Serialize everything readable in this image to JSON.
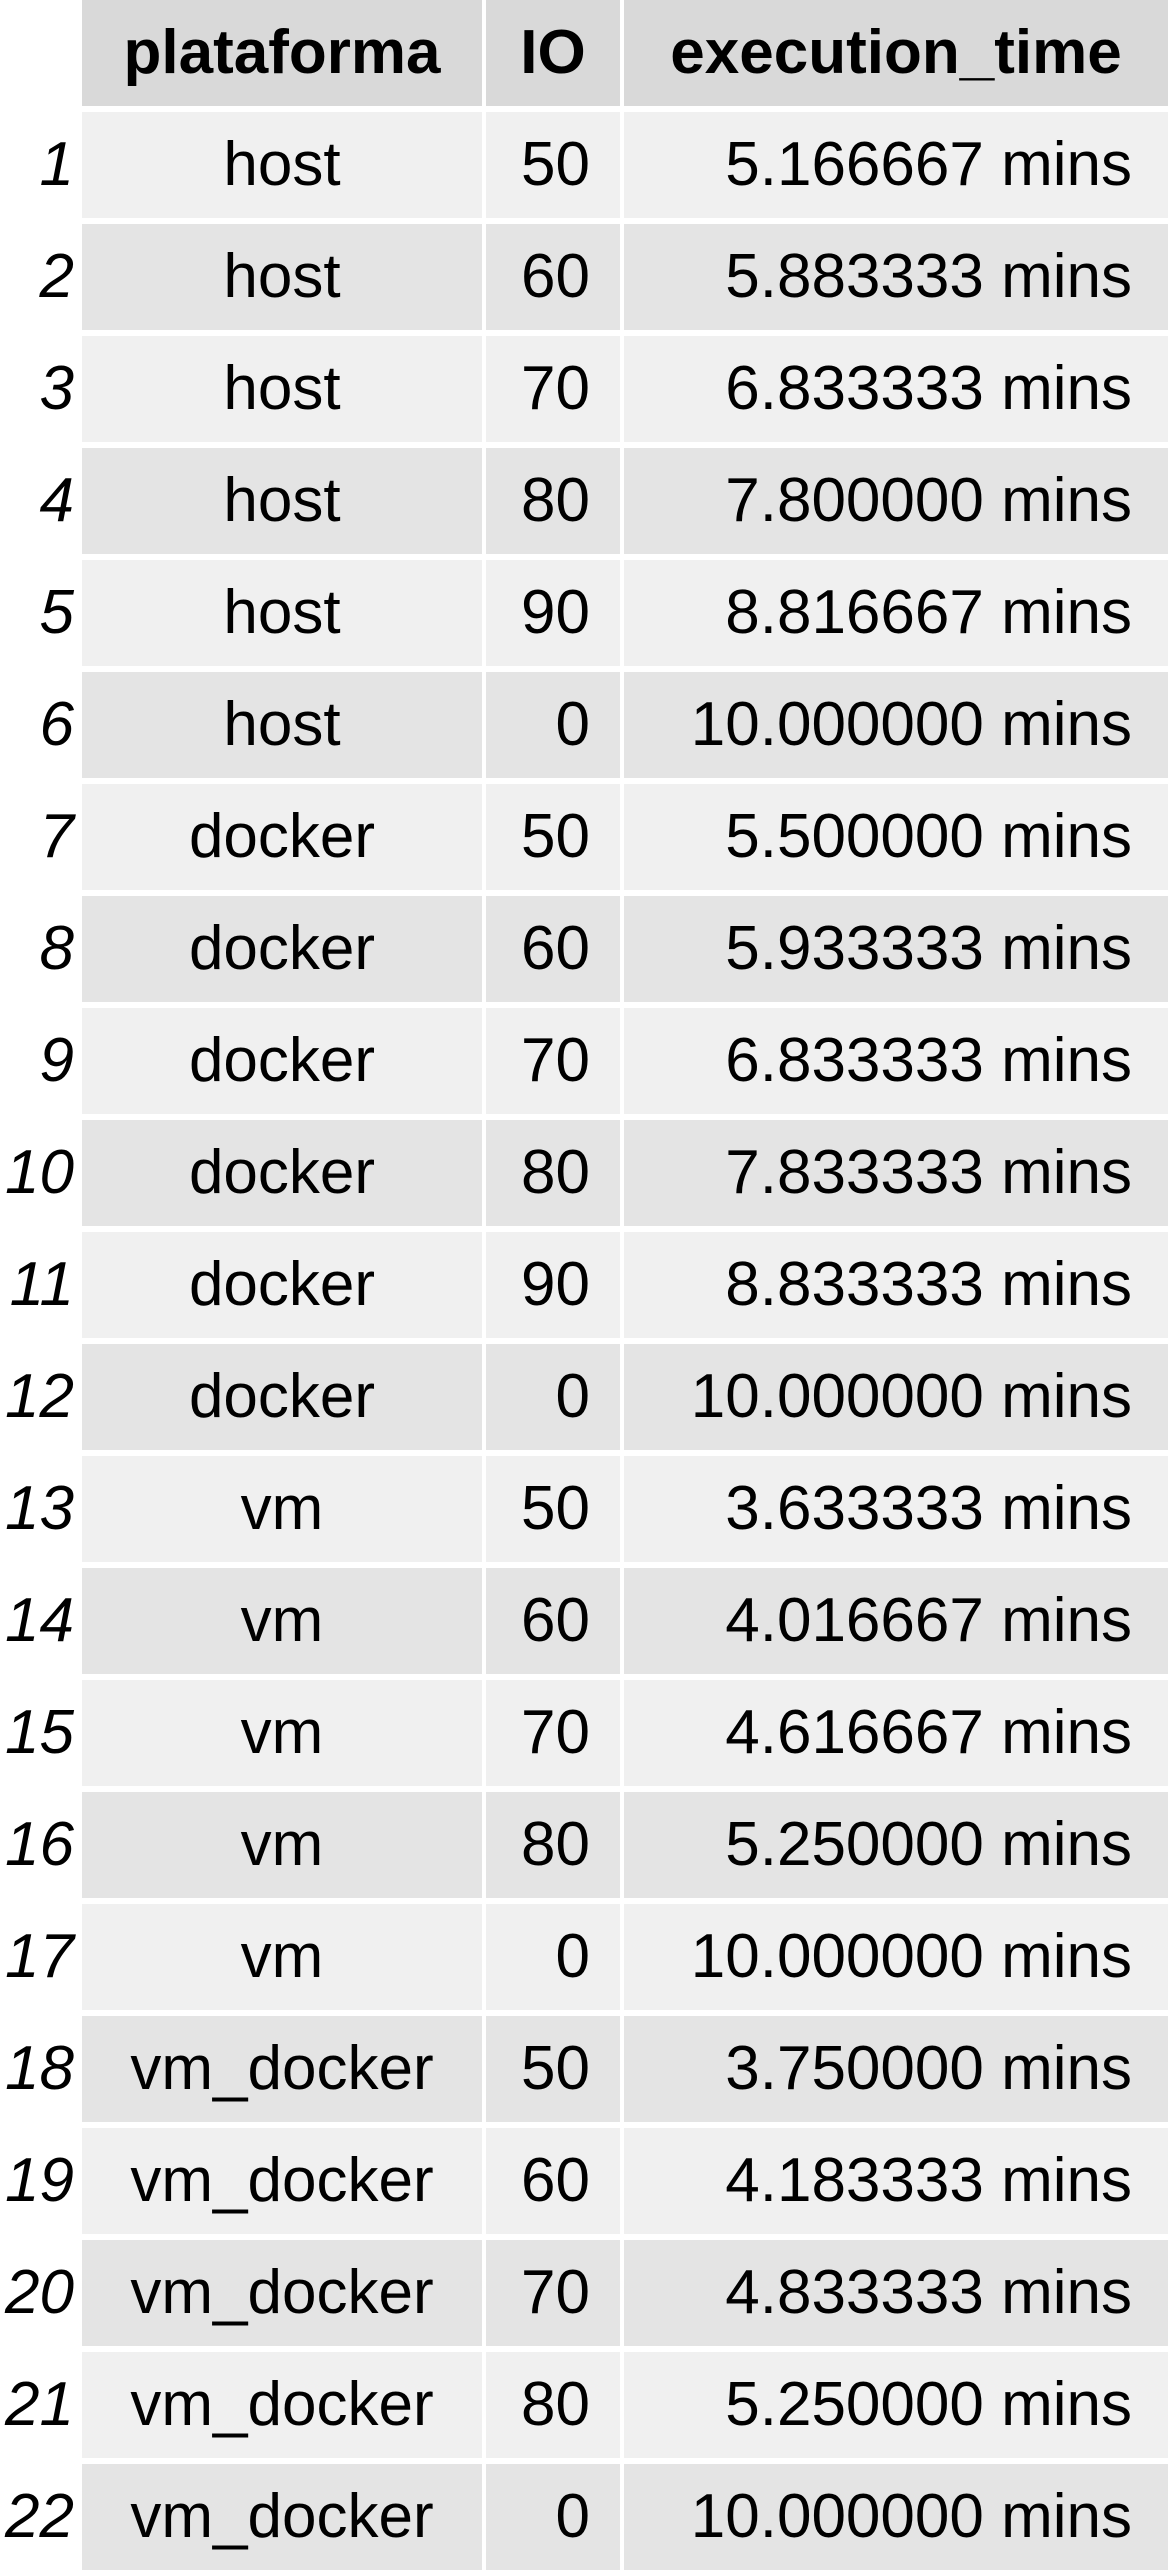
{
  "chart_data": {
    "type": "table",
    "columns": [
      "plataforma",
      "IO",
      "execution_time"
    ],
    "rows": [
      {
        "n": "1",
        "plataforma": "host",
        "IO": "50",
        "execution_time": "5.166667 mins"
      },
      {
        "n": "2",
        "plataforma": "host",
        "IO": "60",
        "execution_time": "5.883333 mins"
      },
      {
        "n": "3",
        "plataforma": "host",
        "IO": "70",
        "execution_time": "6.833333 mins"
      },
      {
        "n": "4",
        "plataforma": "host",
        "IO": "80",
        "execution_time": "7.800000 mins"
      },
      {
        "n": "5",
        "plataforma": "host",
        "IO": "90",
        "execution_time": "8.816667 mins"
      },
      {
        "n": "6",
        "plataforma": "host",
        "IO": "0",
        "execution_time": "10.000000 mins"
      },
      {
        "n": "7",
        "plataforma": "docker",
        "IO": "50",
        "execution_time": "5.500000 mins"
      },
      {
        "n": "8",
        "plataforma": "docker",
        "IO": "60",
        "execution_time": "5.933333 mins"
      },
      {
        "n": "9",
        "plataforma": "docker",
        "IO": "70",
        "execution_time": "6.833333 mins"
      },
      {
        "n": "10",
        "plataforma": "docker",
        "IO": "80",
        "execution_time": "7.833333 mins"
      },
      {
        "n": "11",
        "plataforma": "docker",
        "IO": "90",
        "execution_time": "8.833333 mins"
      },
      {
        "n": "12",
        "plataforma": "docker",
        "IO": "0",
        "execution_time": "10.000000 mins"
      },
      {
        "n": "13",
        "plataforma": "vm",
        "IO": "50",
        "execution_time": "3.633333 mins"
      },
      {
        "n": "14",
        "plataforma": "vm",
        "IO": "60",
        "execution_time": "4.016667 mins"
      },
      {
        "n": "15",
        "plataforma": "vm",
        "IO": "70",
        "execution_time": "4.616667 mins"
      },
      {
        "n": "16",
        "plataforma": "vm",
        "IO": "80",
        "execution_time": "5.250000 mins"
      },
      {
        "n": "17",
        "plataforma": "vm",
        "IO": "0",
        "execution_time": "10.000000 mins"
      },
      {
        "n": "18",
        "plataforma": "vm_docker",
        "IO": "50",
        "execution_time": "3.750000 mins"
      },
      {
        "n": "19",
        "plataforma": "vm_docker",
        "IO": "60",
        "execution_time": "4.183333 mins"
      },
      {
        "n": "20",
        "plataforma": "vm_docker",
        "IO": "70",
        "execution_time": "4.833333 mins"
      },
      {
        "n": "21",
        "plataforma": "vm_docker",
        "IO": "80",
        "execution_time": "5.250000 mins"
      },
      {
        "n": "22",
        "plataforma": "vm_docker",
        "IO": "0",
        "execution_time": "10.000000 mins"
      }
    ]
  },
  "colors": {
    "header_bg": "#d9d9d9",
    "row_odd_bg": "#f0f0f0",
    "row_even_bg": "#e4e4e4"
  }
}
